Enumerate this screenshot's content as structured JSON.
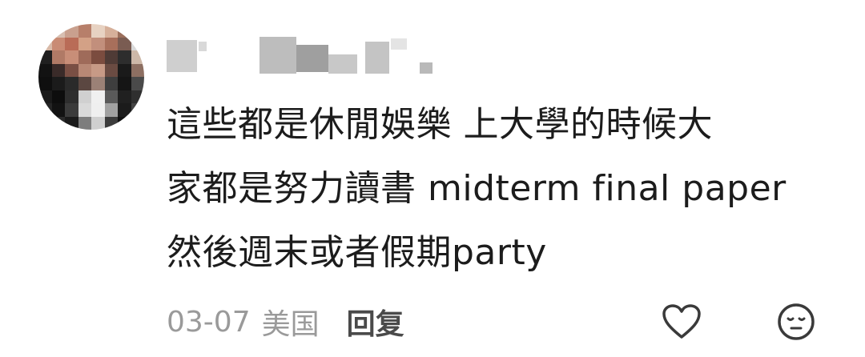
{
  "comment": {
    "username_visible": false,
    "text": "這些都是休閒娛樂 上大學的時候大\n家都是努力讀書 midterm final paper\n然後週末或者假期party",
    "date": "03-07",
    "location": "美国",
    "reply_label": "回复"
  },
  "icons": {
    "like": "heart-outline-icon",
    "emoji": "emoji-face-icon"
  },
  "colors": {
    "text": "#1c1c1c",
    "meta": "#9a9a9a",
    "reply": "#4a4a4a",
    "icon_stroke": "#3a3a3a"
  }
}
